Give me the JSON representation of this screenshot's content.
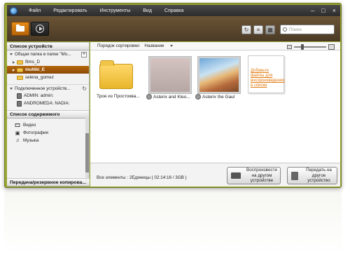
{
  "menubar": {
    "items": [
      "Файл",
      "Редактировать",
      "Инструменты",
      "Вид",
      "Справка"
    ],
    "window_controls": [
      "minimize-icon",
      "maximize-icon",
      "close-icon"
    ]
  },
  "toolbar": {
    "search_placeholder": "Поиск",
    "tabs": [
      {
        "icon": "folder-icon",
        "active": true
      },
      {
        "icon": "play-icon",
        "active": false
      }
    ]
  },
  "sidebar": {
    "devices_header": "Список устройств",
    "shared_folder": "Общая папка в папке \"Мо...",
    "folders": [
      {
        "label": "films_D",
        "selected": false
      },
      {
        "label": "multiki_E",
        "selected": true
      },
      {
        "label": "selena_gomez",
        "selected": false
      }
    ],
    "connected_header": "Подключенное устройств...",
    "connected_devices": [
      "ADMIN: admin:",
      "ANDROMEDA: NADIA:"
    ],
    "content_header": "Список содержимого",
    "content_items": [
      {
        "label": "Видео",
        "icon": "video-icon"
      },
      {
        "label": "Фотографии",
        "icon": "photo-icon"
      },
      {
        "label": "Музыка",
        "icon": "music-icon"
      }
    ],
    "transfer_header": "Передача/резервное копирова..."
  },
  "content": {
    "sort_label": "Порядок сортировки:",
    "sort_value": "Название",
    "tiles": [
      {
        "label": "Трое из Простоква..."
      },
      {
        "label": "Asterix and Kleo..."
      },
      {
        "label": "Asterix the Gaul"
      }
    ],
    "add_tile_text": "Добавьте файлы для воспроизведения в списке",
    "status": "Все элементы : 2Единицы ( 02:14:16 / 3GB )",
    "play_button": "Воспроизвести на другом устройстве",
    "send_button": "Передать на другое устройство"
  },
  "colors": {
    "frame": "#9aa634",
    "accent_orange": "#b5650d",
    "link": "#e07a10"
  }
}
